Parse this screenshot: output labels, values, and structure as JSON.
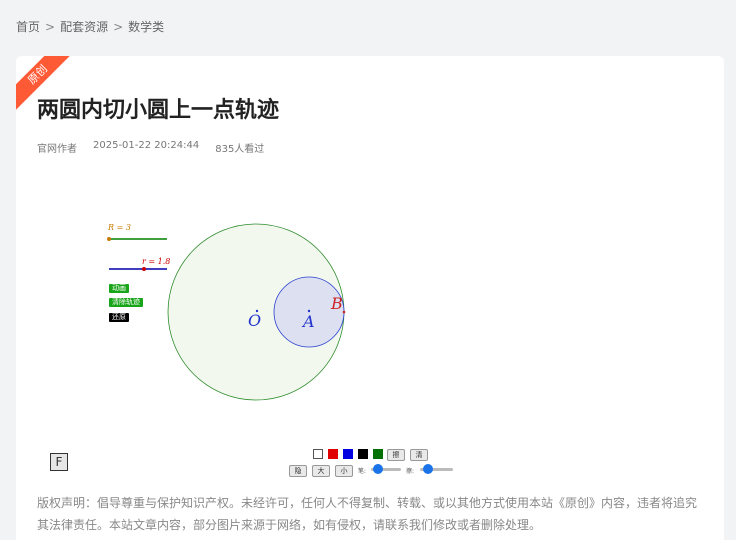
{
  "breadcrumb": {
    "items": [
      "首页",
      "配套资源",
      "数学类"
    ],
    "separator": ">"
  },
  "article": {
    "badge": "原创",
    "title": "两圆内切小圆上一点轨迹",
    "author": "官网作者",
    "datetime": "2025-01-22 20:24:44",
    "views": "835人看过"
  },
  "applet": {
    "slider_R_label": "R = 3",
    "slider_r_label": "r = 1.8",
    "buttons": [
      "动画",
      "清除轨迹",
      "还原"
    ],
    "point_O": "O",
    "point_A": "A",
    "point_B": "B",
    "f_box": "F",
    "toolbar": {
      "colors": [
        "#ffffff",
        "#e00000",
        "#0000e0",
        "#000000",
        "#007000"
      ],
      "btn_erase": "擦",
      "btn_clear": "清",
      "btn_hide": "隐",
      "btn_big": "大",
      "btn_small": "小",
      "label_pen": "笔:",
      "label_eraser": "擦:"
    }
  },
  "copyright": "版权声明：倡导尊重与保护知识产权。未经许可，任何人不得复制、转载、或以其他方式使用本站《原创》内容，违者将追究其法律责任。本站文章内容，部分图片来源于网络，如有侵权，请联系我们修改或者删除处理。"
}
